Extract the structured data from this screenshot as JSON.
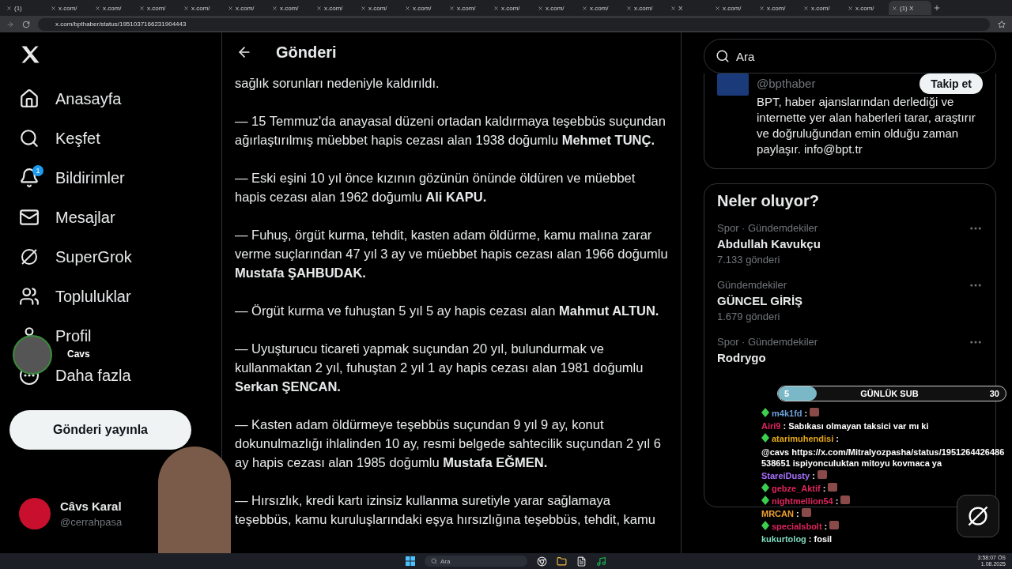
{
  "browser": {
    "tabs": [
      {
        "title": "(1)",
        "selected": false
      },
      {
        "title": "x.com/",
        "selected": false
      },
      {
        "title": "x.com/",
        "selected": false
      },
      {
        "title": "x.com/",
        "selected": false
      },
      {
        "title": "x.com/",
        "selected": false
      },
      {
        "title": "x.com/",
        "selected": false
      },
      {
        "title": "x.com/",
        "selected": false
      },
      {
        "title": "x.com/",
        "selected": false
      },
      {
        "title": "x.com/",
        "selected": false
      },
      {
        "title": "x.com/",
        "selected": false
      },
      {
        "title": "x.com/",
        "selected": false
      },
      {
        "title": "x.com/",
        "selected": false
      },
      {
        "title": "x.com/",
        "selected": false
      },
      {
        "title": "x.com/",
        "selected": false
      },
      {
        "title": "x.com/",
        "selected": false
      },
      {
        "title": "X",
        "selected": false
      },
      {
        "title": "x.com/",
        "selected": false
      },
      {
        "title": "x.com/",
        "selected": false
      },
      {
        "title": "x.com/",
        "selected": false
      },
      {
        "title": "x.com/",
        "selected": false
      },
      {
        "title": "(1) X",
        "selected": true
      }
    ],
    "url": "x.com/bpthaber/status/1951037166231904443"
  },
  "sidebar": {
    "items": [
      {
        "label": "Anasayfa",
        "kind": "home"
      },
      {
        "label": "Keşfet",
        "kind": "search"
      },
      {
        "label": "Bildirimler",
        "kind": "bell",
        "badge": "1"
      },
      {
        "label": "Mesajlar",
        "kind": "mail"
      },
      {
        "label": "SuperGrok",
        "kind": "grok"
      },
      {
        "label": "Topluluklar",
        "kind": "people"
      },
      {
        "label": "Profil",
        "kind": "user"
      },
      {
        "label": "Daha fazla",
        "kind": "more"
      }
    ],
    "post_button": "Gönderi yayınla",
    "account": {
      "name": "Câvs Karal",
      "handle": "@cerrahpasa"
    }
  },
  "webcam_label": "Cavs",
  "post": {
    "header": "Gönderi",
    "paragraphs": [
      "sağlık sorunları nedeniyle kaldırıldı.",
      "— 15 Temmuz'da anayasal düzeni ortadan kaldırmaya teşebbüs suçundan ağırlaştırılmış müebbet hapis cezası alan 1938 doğumlu **Mehmet TUNÇ.**",
      "— Eski eşini 10 yıl önce kızının gözünün önünde öldüren ve müebbet hapis cezası alan 1962 doğumlu **Ali KAPU.**",
      "— Fuhuş, örgüt kurma, tehdit, kasten adam öldürme, kamu malına zarar verme suçlarından 47 yıl 3 ay ve müebbet hapis cezası alan 1966 doğumlu **Mustafa ŞAHBUDAK.**",
      "— Örgüt kurma ve fuhuştan 5 yıl 5 ay hapis cezası alan **Mahmut ALTUN.**",
      "— Uyuşturucu ticareti yapmak suçundan 20 yıl, bulundurmak ve kullanmaktan 2 yıl, fuhuştan 2 yıl 1 ay hapis cezası alan 1981 doğumlu **Serkan ŞENCAN.**",
      "— Kasten adam öldürmeye teşebbüs suçundan 9 yıl 9 ay, konut dokunulmazlığı ihlalinden 10 ay, resmi belgede sahtecilik suçundan 2 yıl 6 ay hapis cezası alan 1985 doğumlu **Mustafa EĞMEN.**",
      "— Hırsızlık, kredi kartı izinsiz kullanma suretiyle yarar sağlamaya teşebbüs, kamu kuruluşlarındaki eşya hırsızlığına teşebbüs, tehdit, kamu"
    ]
  },
  "right": {
    "search": {
      "placeholder": "Ara"
    },
    "profile_card": {
      "handle": "@bpthaber",
      "follow": "Takip et",
      "bio": "BPT, haber ajanslarından derlediği ve internette yer alan haberleri tarar, araştırır ve doğruluğundan emin olduğu zaman paylaşır. info@bpt.tr"
    },
    "trends": {
      "title": "Neler oluyor?",
      "items": [
        {
          "category": "Spor · Gündemdekiler",
          "name": "Abdullah Kavukçu",
          "count": "7.133 gönderi"
        },
        {
          "category": "Gündemdekiler",
          "name": "GÜNCEL GİRİŞ",
          "count": "1.679 gönderi"
        },
        {
          "category": "Spor · Gündemdekiler",
          "name": "Rodrygo"
        }
      ]
    }
  },
  "sub_goal": {
    "current": "5",
    "label": "GÜNLÜK SUB",
    "target": "30",
    "level": 0.17
  },
  "chat": [
    {
      "user": "m4k1fd",
      "sep": ":",
      "color": "#6f9fd8",
      "badge": true,
      "kind": "emote"
    },
    {
      "user": "Airi9",
      "sep": ":",
      "color": "#e0245e",
      "badge": false,
      "kind": "text",
      "message": "Sabıkası olmayan taksici var mı ki"
    },
    {
      "user": "atarimuhendisi",
      "sep": ":",
      "color": "#e6a817",
      "badge": true,
      "kind": "text",
      "message": "@cavs https://x.com/Mitralyozpasha/status/1951264426486538651 ispiyonculuktan mitoyu kovmaca ya"
    },
    {
      "user": "StareiDusty",
      "sep": ":",
      "color": "#a970ff",
      "badge": false,
      "kind": "emote"
    },
    {
      "user": "gebze_Aktif",
      "sep": ":",
      "color": "#e0245e",
      "badge": true,
      "kind": "emote"
    },
    {
      "user": "nightmellion54",
      "sep": ":",
      "color": "#e0245e",
      "badge": true,
      "kind": "emote"
    },
    {
      "user": "MRCAN",
      "sep": ":",
      "color": "#f0a030",
      "badge": false,
      "kind": "emote"
    },
    {
      "user": "specialsbolt",
      "sep": ":",
      "color": "#e0245e",
      "badge": true,
      "kind": "emote"
    },
    {
      "user": "kukurtolog",
      "sep": ":",
      "color": "#7fd8be",
      "badge": false,
      "kind": "text",
      "message": "fosil"
    }
  ],
  "taskbar": {
    "search": {
      "placeholder": "Ara"
    },
    "time": "3:58:07 ÖS",
    "date": "1.08.2025"
  }
}
